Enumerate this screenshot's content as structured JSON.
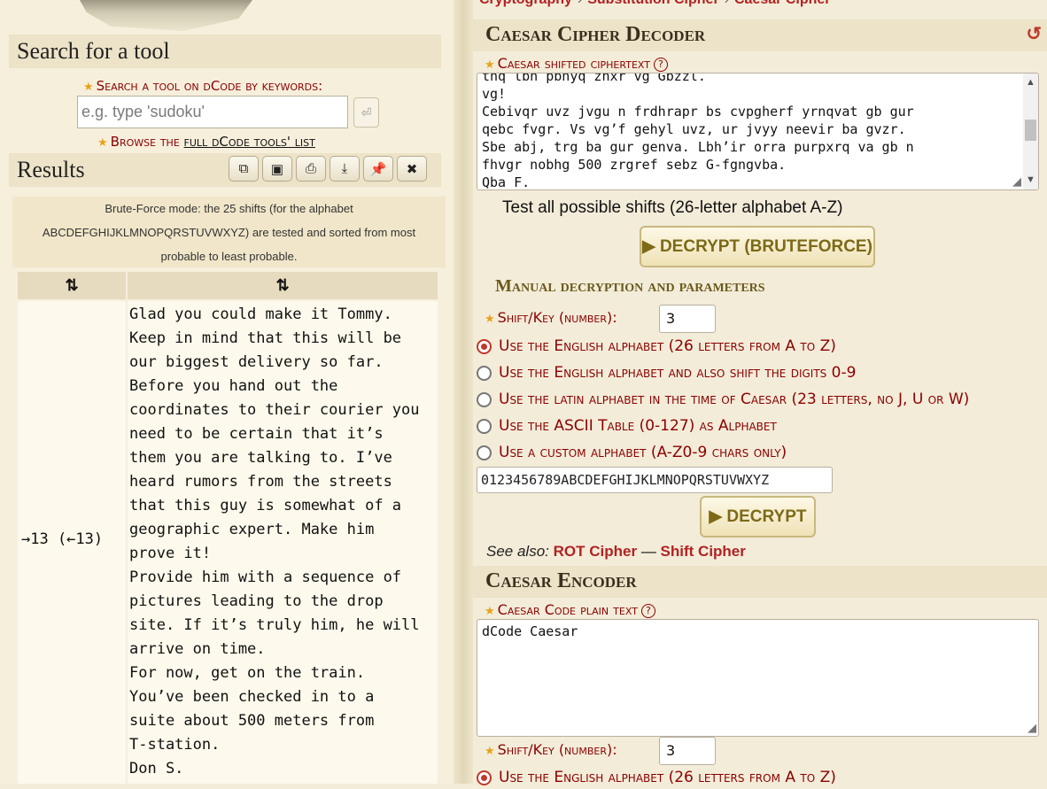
{
  "left": {
    "search_title": "Search for a tool",
    "search_label": "Search a tool on dCode by keywords:",
    "search_placeholder": "e.g. type 'sudoku'",
    "browse_prefix": "Browse the ",
    "browse_link": "full dCode tools' list",
    "results_title": "Results",
    "toolbar_icons": [
      "copy-icon",
      "save-icon",
      "print-icon",
      "download-icon",
      "pin-icon",
      "close-icon"
    ],
    "brute_info": "Brute-Force mode: the 25 shifts (for the alphabet ABCDEFGHIJKLMNOPQRSTUVWXYZ) are tested and sorted from most probable to least probable.",
    "col_key_header": "⇅",
    "col_text_header": "⇅",
    "result_key": "→13 (←13)",
    "result_text": "Glad you could make it Tommy.\nKeep in mind that this will be\nour biggest delivery so far.\nBefore you hand out the\ncoordinates to their courier you\nneed to be certain that it’s\nthem you are talking to. I’ve\nheard rumors from the streets\nthat this guy is somewhat of a\ngeographic expert. Make him\nprove it!\nProvide him with a sequence of\npictures leading to the drop\nsite. If it’s truly him, he will\narrive on time.\nFor now, get on the train.\nYou’ve been checked in to a\nsuite about 500 meters from\nT-station.\nDon S."
  },
  "right": {
    "breadcrumb": [
      "Cryptography",
      "Substitution Cipher",
      "Caesar Cipher"
    ],
    "decoder_title": "Caesar Cipher Decoder",
    "ciphertext_label": "Caesar shifted ciphertext",
    "ciphertext_value": "tnq lbh pbhyq znxr vg Gbzzl.\nvg!\nCebivqr uvz jvgu n frdhrapr bs cvpgherf yrnqvat gb gur\nqebc fvgr. Vs vg’f gehyl uvz, ur jvyy neevir ba gvzr.\nSbe abj, trg ba gur genva. Lbh’ir orra purpxrq va gb n\nfhvgr nobhg 500 zrgref sebz G-fgngvba.\nQba F.",
    "test_all_label": "Test all possible shifts (26-letter alphabet A-Z)",
    "bruteforce_button": "▶ DECRYPT (BRUTEFORCE)",
    "manual_head": "Manual decryption and parameters",
    "shift_label": "Shift/Key (number):",
    "shift_value": "3",
    "alphabet_options": [
      "Use the English alphabet (26 letters from A to Z)",
      "Use the English alphabet and also shift the digits 0-9",
      "Use the latin alphabet in the time of Caesar (23 letters, no J, U or W)",
      "Use the ASCII Table (0-127) as Alphabet",
      "Use a custom alphabet (A-Z0-9 chars only)"
    ],
    "custom_alphabet": "0123456789ABCDEFGHIJKLMNOPQRSTUVWXYZ",
    "decrypt_button": "▶ DECRYPT",
    "see_also_label": "See also:",
    "see_also_links": [
      "ROT Cipher",
      "Shift Cipher"
    ],
    "see_also_sep": "—",
    "encoder_title": "Caesar Encoder",
    "plain_label": "Caesar Code plain text",
    "plain_value": "dCode Caesar",
    "enc_shift_label": "Shift/Key (number):",
    "enc_shift_value": "3",
    "enc_alphabet_first": "Use the English alphabet (26 letters from A to Z)"
  },
  "colors": {
    "accent_red": "#8b0000",
    "link_red": "#b22222",
    "panel_bg": "#ece3c8",
    "button_text": "#7d6a17"
  }
}
